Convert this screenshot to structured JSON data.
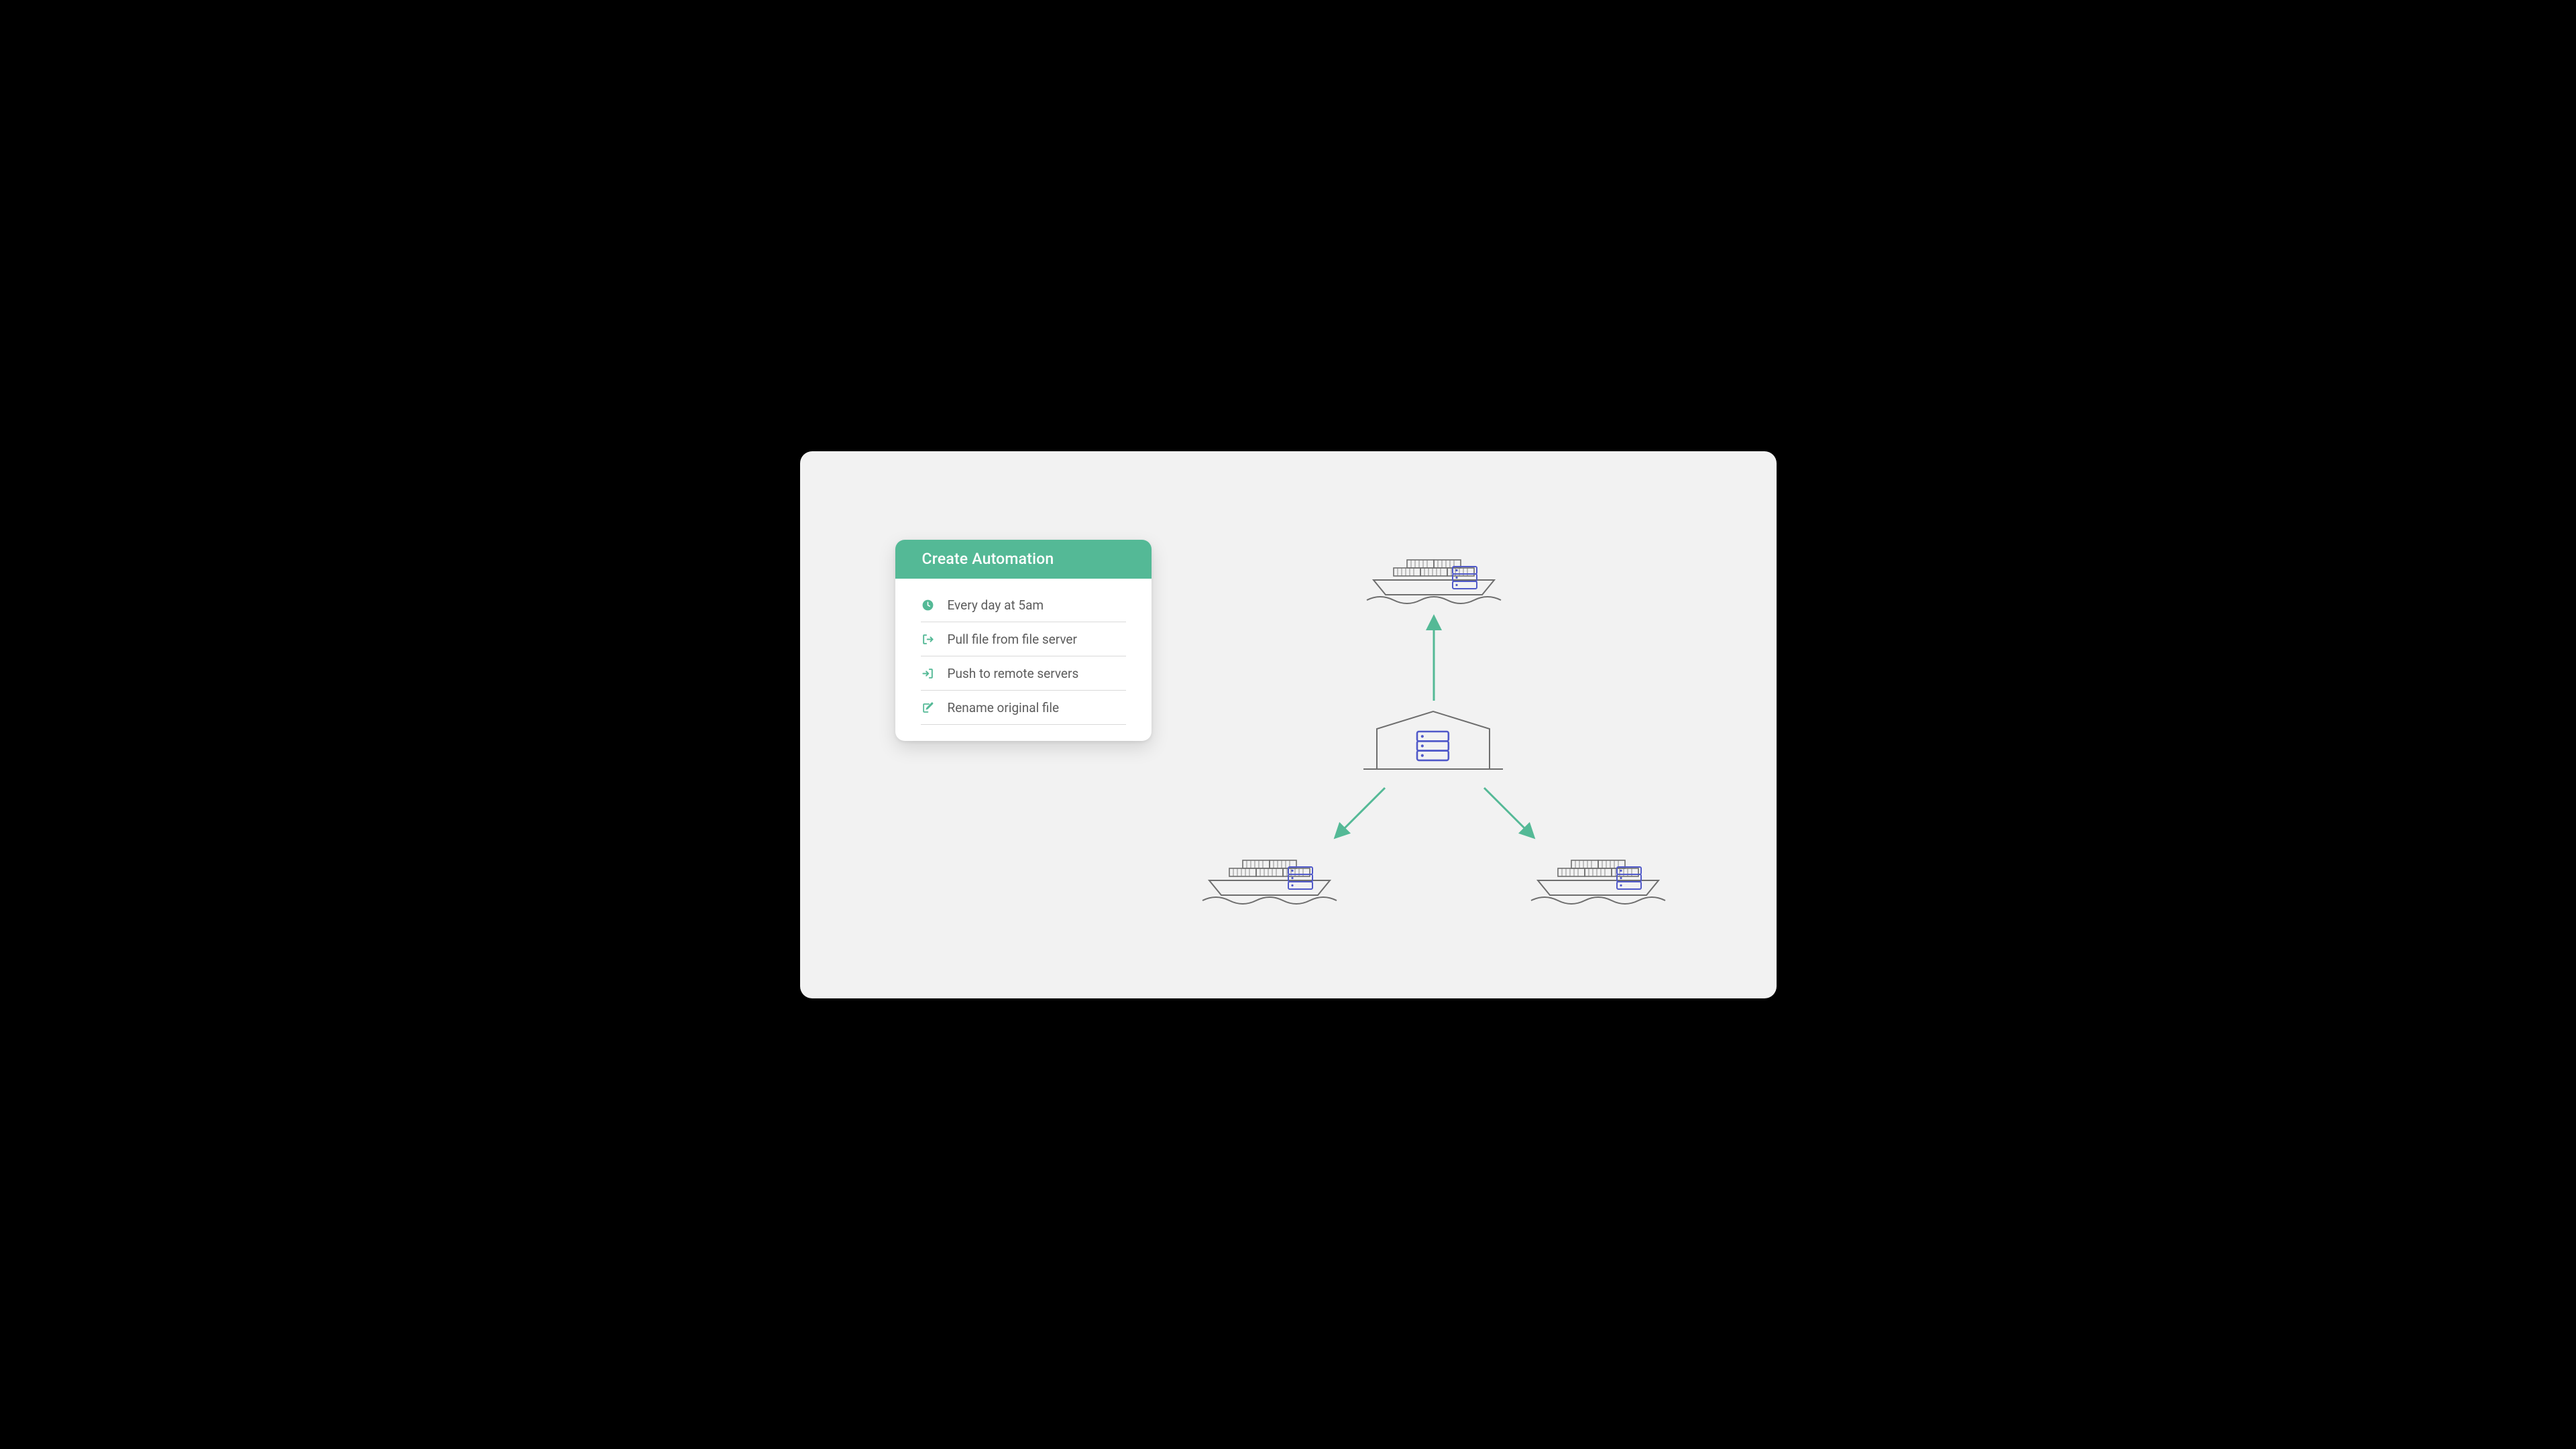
{
  "card": {
    "title": "Create Automation",
    "rows": [
      {
        "icon": "clock-icon",
        "label": "Every day at 5am"
      },
      {
        "icon": "export-icon",
        "label": "Pull file from file server"
      },
      {
        "icon": "import-icon",
        "label": "Push to remote servers"
      },
      {
        "icon": "edit-icon",
        "label": "Rename original file"
      }
    ]
  },
  "colors": {
    "accent": "#54b996",
    "icon": "#5059c9",
    "stroke": "#6e6e6e",
    "text": "#5c5c5c",
    "bg": "#f2f2f2"
  },
  "diagram": {
    "description": "Central warehouse/server distributes to three container ships (top, bottom-left, bottom-right). Top arrow points up to ship; two diagonal arrows point down to bottom ships.",
    "nodes": [
      {
        "id": "warehouse",
        "type": "warehouse-server",
        "position": "center"
      },
      {
        "id": "ship-top",
        "type": "container-ship-server",
        "position": "top"
      },
      {
        "id": "ship-bl",
        "type": "container-ship-server",
        "position": "bottom-left"
      },
      {
        "id": "ship-br",
        "type": "container-ship-server",
        "position": "bottom-right"
      }
    ],
    "arrows": [
      {
        "from": "warehouse",
        "to": "ship-top",
        "direction": "up"
      },
      {
        "from": "warehouse",
        "to": "ship-bl",
        "direction": "down-left"
      },
      {
        "from": "warehouse",
        "to": "ship-br",
        "direction": "down-right"
      }
    ]
  }
}
